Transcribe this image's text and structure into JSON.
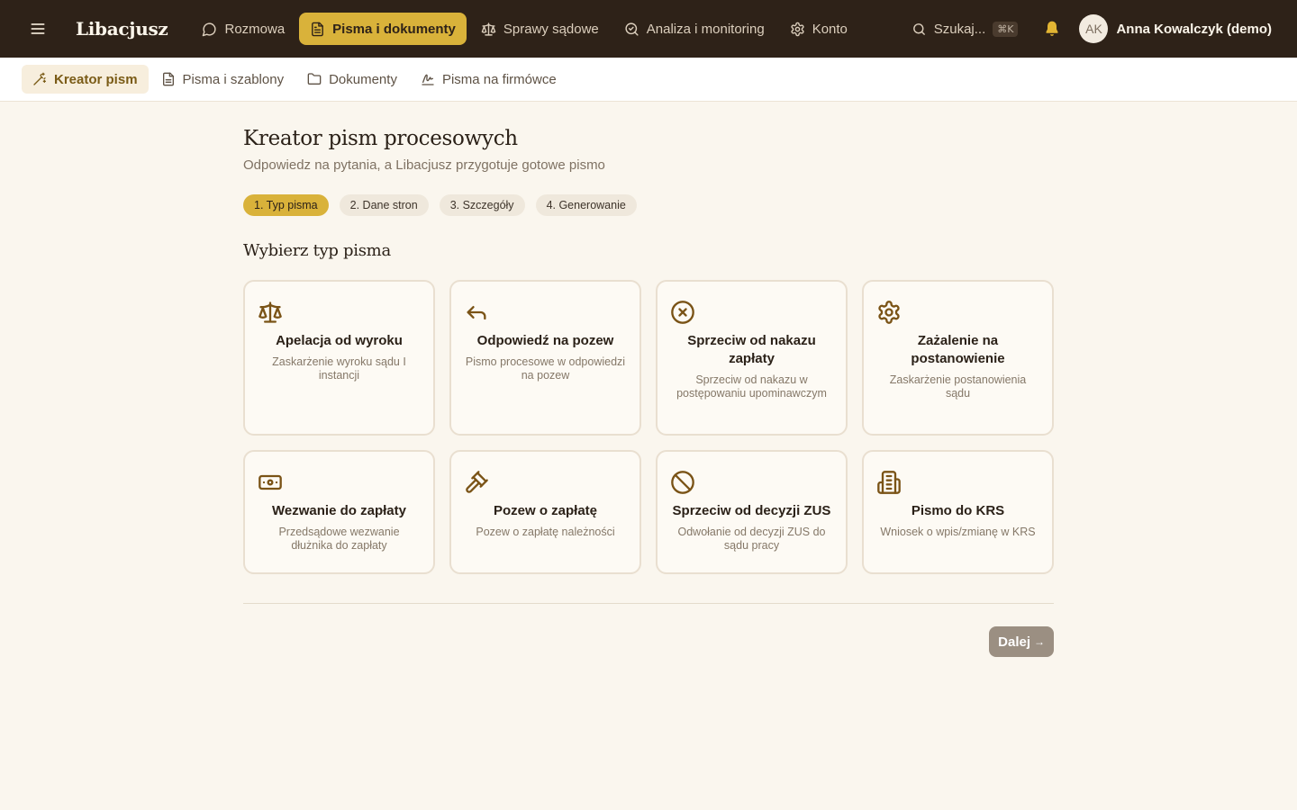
{
  "app": {
    "name": "Libacjusz"
  },
  "nav": {
    "items": [
      {
        "label": "Rozmowa",
        "icon": "chat-icon"
      },
      {
        "label": "Pisma i dokumenty",
        "icon": "document-icon",
        "active": true
      },
      {
        "label": "Sprawy sądowe",
        "icon": "scale-icon"
      },
      {
        "label": "Analiza i monitoring",
        "icon": "search-analysis-icon"
      },
      {
        "label": "Konto",
        "icon": "gear-icon"
      }
    ]
  },
  "search": {
    "label": "Szukaj...",
    "shortcut": "⌘K"
  },
  "user": {
    "initials": "AK",
    "name": "Anna Kowalczyk (demo)"
  },
  "subnav": {
    "items": [
      {
        "label": "Kreator pism",
        "icon": "magic-wand-icon",
        "active": true
      },
      {
        "label": "Pisma i szablony",
        "icon": "file-text-icon"
      },
      {
        "label": "Dokumenty",
        "icon": "folder-icon"
      },
      {
        "label": "Pisma na firmówce",
        "icon": "signature-icon"
      }
    ]
  },
  "page": {
    "title": "Kreator pism procesowych",
    "subtitle": "Odpowiedz na pytania, a Libacjusz przygotuje gotowe pismo"
  },
  "steps": [
    {
      "label": "1. Typ pisma",
      "active": true
    },
    {
      "label": "2. Dane stron"
    },
    {
      "label": "3. Szczegóły"
    },
    {
      "label": "4. Generowanie"
    }
  ],
  "section": {
    "title": "Wybierz typ pisma"
  },
  "document_types": [
    {
      "title": "Apelacja od wyroku",
      "desc": "Zaskarżenie wyroku sądu I instancji",
      "icon": "scale-icon"
    },
    {
      "title": "Odpowiedź na pozew",
      "desc": "Pismo procesowe w odpowiedzi na pozew",
      "icon": "reply-arrow-icon"
    },
    {
      "title": "Sprzeciw od nakazu zapłaty",
      "desc": "Sprzeciw od nakazu w postępowaniu upominawczym",
      "icon": "x-circle-icon"
    },
    {
      "title": "Zażalenie na postanowienie",
      "desc": "Zaskarżenie postanowienia sądu",
      "icon": "gear-icon"
    },
    {
      "title": "Wezwanie do zapłaty",
      "desc": "Przedsądowe wezwanie dłużnika do zapłaty",
      "icon": "banknote-icon"
    },
    {
      "title": "Pozew o zapłatę",
      "desc": "Pozew o zapłatę należności",
      "icon": "gavel-icon"
    },
    {
      "title": "Sprzeciw od decyzji ZUS",
      "desc": "Odwołanie od decyzji ZUS do sądu pracy",
      "icon": "ban-icon"
    },
    {
      "title": "Pismo do KRS",
      "desc": "Wniosek o wpis/zmianę w KRS",
      "icon": "building-icon"
    }
  ],
  "actions": {
    "next_label": "Dalej",
    "next_arrow": "→"
  },
  "colors": {
    "topbar": "#2e2218",
    "accent": "#d9b23a",
    "background": "#faf6ee",
    "icon": "#7a5316",
    "disabled_button": "#9b8f82"
  }
}
